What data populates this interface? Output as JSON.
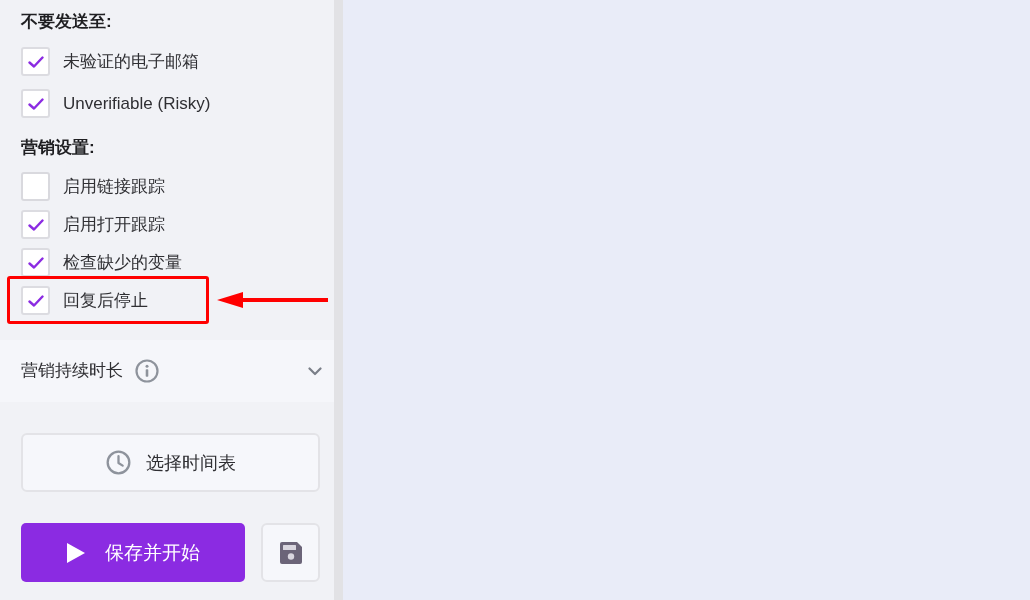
{
  "sidebar": {
    "exclusions": {
      "heading": "不要发送至:",
      "options": [
        {
          "label": "未验证的电子邮箱",
          "checked": true,
          "highlighted": false
        },
        {
          "label": "Unverifiable (Risky)",
          "checked": true,
          "highlighted": false
        }
      ]
    },
    "campaign_settings": {
      "heading": "营销设置:",
      "options": [
        {
          "label": "启用链接跟踪",
          "checked": false,
          "highlighted": false
        },
        {
          "label": "启用打开跟踪",
          "checked": true,
          "highlighted": false
        },
        {
          "label": "检查缺少的变量",
          "checked": true,
          "highlighted": false
        },
        {
          "label": "回复后停止",
          "checked": true,
          "highlighted": true
        }
      ]
    },
    "duration_section": {
      "label": "营销持续时长",
      "expanded": false
    },
    "schedule_button": {
      "label": "选择时间表"
    },
    "start_button": {
      "label": "保存并开始"
    }
  }
}
